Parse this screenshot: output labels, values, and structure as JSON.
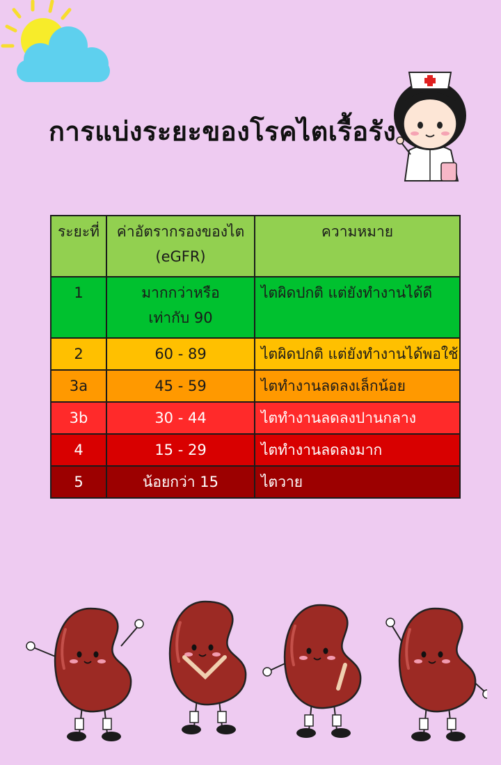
{
  "title": "การแบ่งระยะของโรคไตเรื้อรัง",
  "table": {
    "headers": {
      "stage": "ระยะที่",
      "egfr_line1": "ค่าอัตรากรองของไต",
      "egfr_line2": "(eGFR)",
      "meaning": "ความหมาย"
    },
    "rows": [
      {
        "stage": "1",
        "egfr_line1": "มากกว่าหรือ",
        "egfr_line2": "เท่ากับ 90",
        "meaning": "ไตผิดปกติ แต่ยังทำงานได้ดี",
        "color": "#00c12f"
      },
      {
        "stage": "2",
        "egfr_line1": "60 - 89",
        "egfr_line2": "",
        "meaning": "ไตผิดปกติ แต่ยังทำงานได้พอใช้",
        "color": "#ffc000"
      },
      {
        "stage": "3a",
        "egfr_line1": "45 - 59",
        "egfr_line2": "",
        "meaning": "ไตทำงานลดลงเล็กน้อย",
        "color": "#ff9900"
      },
      {
        "stage": "3b",
        "egfr_line1": "30 - 44",
        "egfr_line2": "",
        "meaning": "ไตทำงานลดลงปานกลาง",
        "color": "#ff2a2a"
      },
      {
        "stage": "4",
        "egfr_line1": "15 - 29",
        "egfr_line2": "",
        "meaning": "ไตทำงานลดลงมาก",
        "color": "#d80000"
      },
      {
        "stage": "5",
        "egfr_line1": "น้อยกว่า 15",
        "egfr_line2": "",
        "meaning": "ไตวาย",
        "color": "#9c0000"
      }
    ]
  },
  "colors": {
    "background": "#eecbf1",
    "header": "#92d050",
    "kidney": "#9c2a24"
  },
  "icons": [
    "sun-icon",
    "cloud-icon",
    "nurse-illustration",
    "kidney-character"
  ]
}
